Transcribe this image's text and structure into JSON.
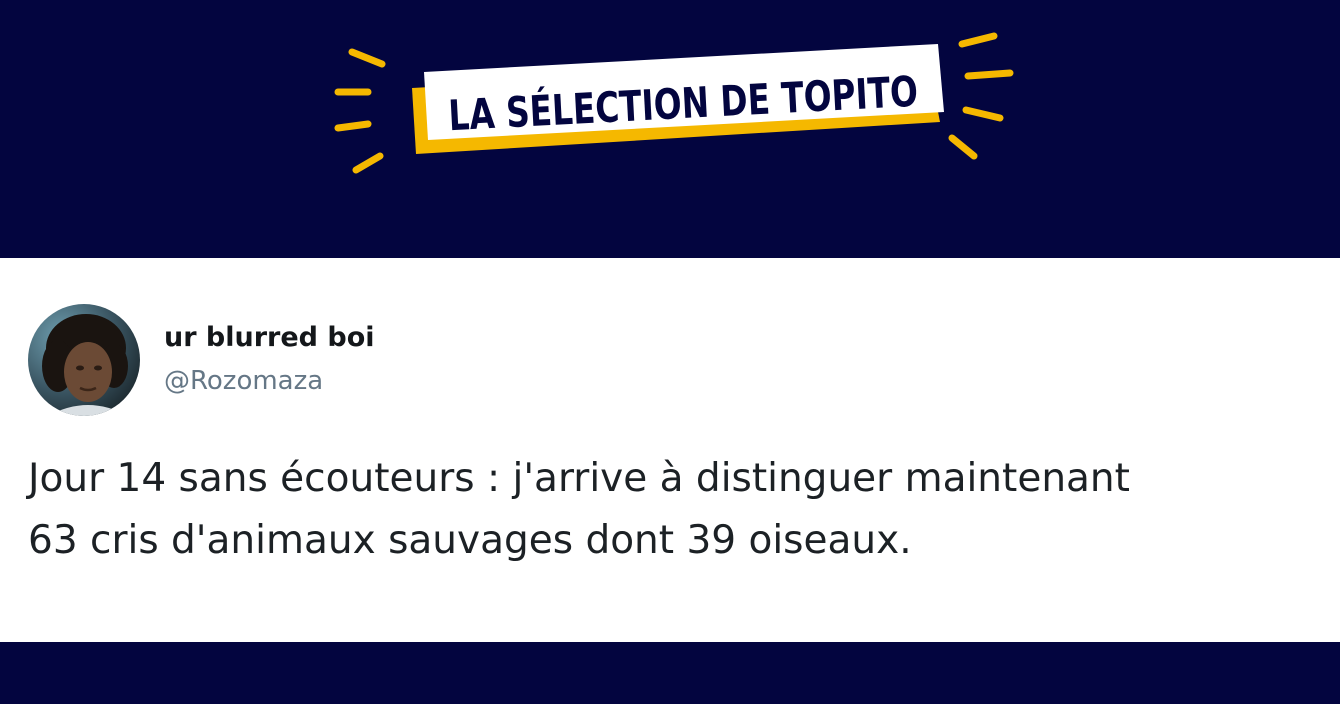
{
  "banner": {
    "title": "LA SÉLECTION DE TOPITO",
    "accent_color": "#f5b800",
    "background_color": "#03053f"
  },
  "tweet": {
    "author_name": "ur blurred boi",
    "author_handle": "@Rozomaza",
    "text_lines": [
      "Jour 14 sans écouteurs : j'arrive à distinguer maintenant",
      "63 cris d'animaux sauvages dont 39 oiseaux."
    ],
    "avatar": "profile-photo"
  }
}
